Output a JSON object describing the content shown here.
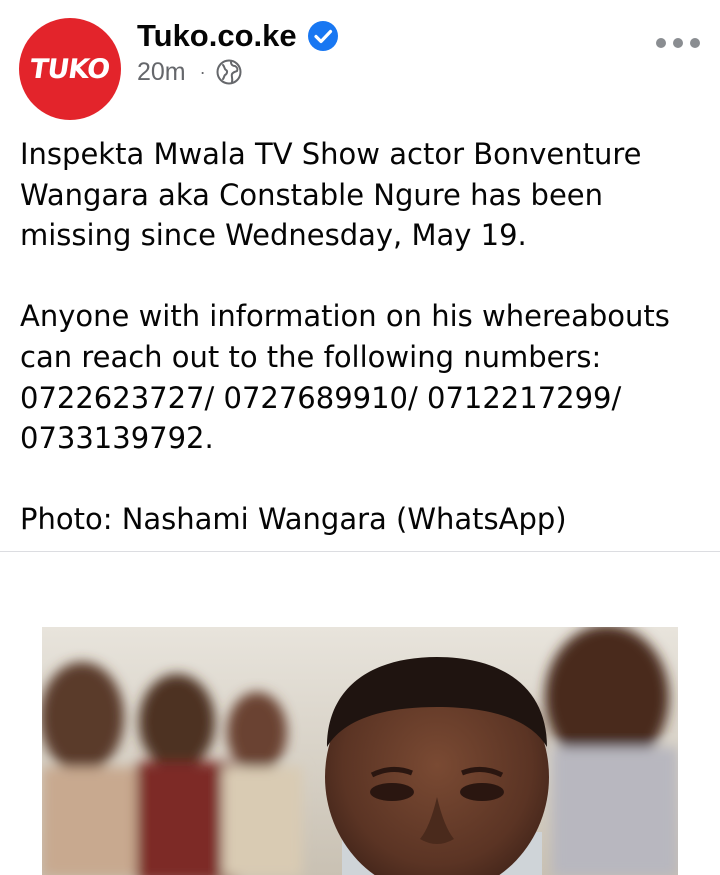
{
  "post": {
    "page_name": "Tuko.co.ke",
    "avatar_text": "TUKO",
    "time_ago": "20m",
    "meta_separator": "·",
    "audience_icon": "globe-icon",
    "verified_icon": "verified-badge-icon",
    "more_icon": "more-horizontal-icon",
    "paragraphs": [
      "Inspekta Mwala TV Show actor Bonventure Wangara aka Constable Ngure has been missing since Wednesday, May 19.",
      "Anyone with information on his whereabouts can reach out to the following numbers: 0722623727/ 0727689910/ 0712217299/ 0733139792.",
      "Photo: Nashami Wangara (WhatsApp)"
    ]
  },
  "colors": {
    "brand_red": "#e3242b",
    "verified_blue": "#1877f2",
    "meta_gray": "#65676b",
    "text": "#050505"
  }
}
